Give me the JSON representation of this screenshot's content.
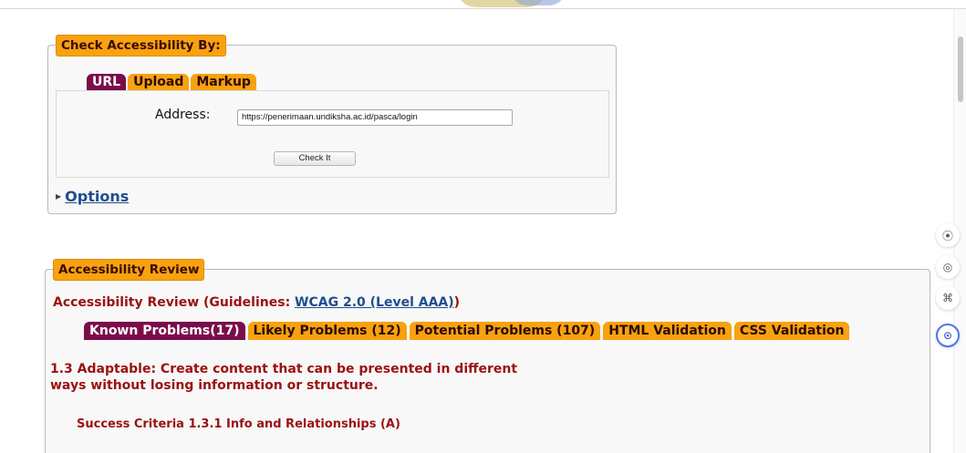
{
  "check": {
    "legend": "Check Accessibility By:",
    "tabs": [
      {
        "label": "URL",
        "active": true
      },
      {
        "label": "Upload",
        "active": false
      },
      {
        "label": "Markup",
        "active": false
      }
    ],
    "address_label": "Address:",
    "address_value": "https://penerimaan.undiksha.ac.id/pasca/login",
    "check_button": "Check It",
    "options_label": "Options"
  },
  "review": {
    "legend": "Accessibility Review",
    "title_prefix": "Accessibility Review (Guidelines: ",
    "title_link": "WCAG 2.0 (Level AAA)",
    "title_suffix": ")",
    "tabs": [
      {
        "label": "Known Problems(17)",
        "active": true
      },
      {
        "label": "Likely Problems (12)",
        "active": false
      },
      {
        "label": "Potential Problems (107)",
        "active": false
      },
      {
        "label": "HTML Validation",
        "active": false
      },
      {
        "label": "CSS Validation",
        "active": false
      }
    ],
    "guideline": "1.3 Adaptable: Create content that can be presented in different ways without losing information or structure.",
    "criteria": "Success Criteria 1.3.1 Info and Relationships (A)"
  },
  "rail": {
    "icons": [
      "book-icon",
      "copilot-icon",
      "grid-icon",
      "assistant-icon"
    ],
    "glyphs": [
      "⦿",
      "◎",
      "⌘",
      "⊙"
    ]
  },
  "colors": {
    "legend_bg": "#f7a20f",
    "active_tab": "#7b0c4a",
    "heading_red": "#9b1111",
    "link_blue": "#1f4d8c"
  }
}
